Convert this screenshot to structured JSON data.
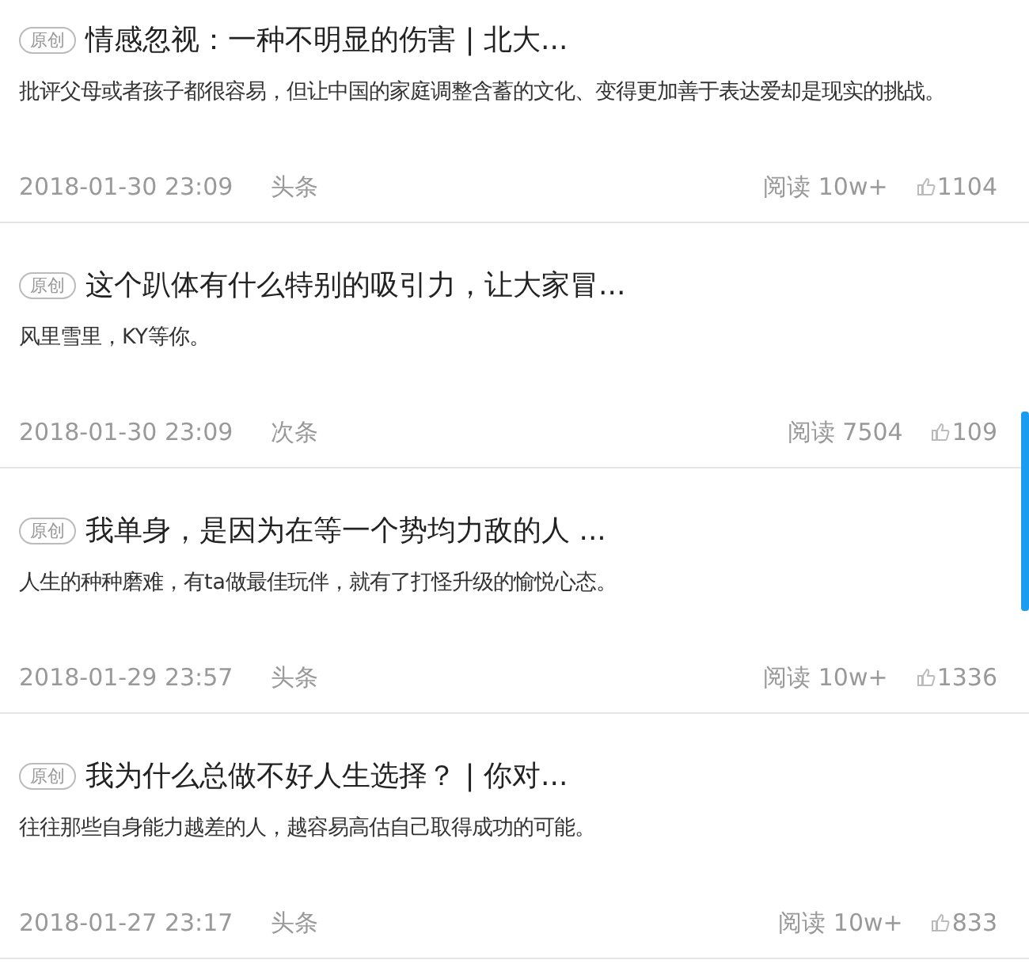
{
  "articles": [
    {
      "tag": "原创",
      "title": "情感忽视：一种不明显的伤害 | 北大...",
      "summary": "批评父母或者孩子都很容易，但让中国的家庭调整含蓄的文化、变得更加善于表达爱却是现实的挑战。",
      "date": "2018-01-30 23:09",
      "position": "头条",
      "reads": "阅读 10w+",
      "likes": "1104"
    },
    {
      "tag": "原创",
      "title": "这个趴体有什么特别的吸引力，让大家冒...",
      "summary": "风里雪里，KY等你。",
      "date": "2018-01-30 23:09",
      "position": "次条",
      "reads": "阅读 7504",
      "likes": "109"
    },
    {
      "tag": "原创",
      "title": "我单身，是因为在等一个势均力敌的人 ...",
      "summary": "人生的种种磨难，有ta做最佳玩伴，就有了打怪升级的愉悦心态。",
      "date": "2018-01-29 23:57",
      "position": "头条",
      "reads": "阅读 10w+",
      "likes": "1336"
    },
    {
      "tag": "原创",
      "title": "我为什么总做不好人生选择？ | 你对...",
      "summary": "往往那些自身能力越差的人，越容易高估自己取得成功的可能。",
      "date": "2018-01-27 23:17",
      "position": "头条",
      "reads": "阅读 10w+",
      "likes": "833"
    }
  ]
}
